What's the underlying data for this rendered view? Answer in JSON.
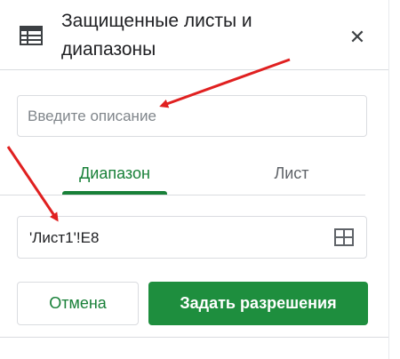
{
  "header": {
    "title_line1": "Защищенные листы и",
    "title_line2": "диапазоны"
  },
  "description": {
    "placeholder": "Введите описание",
    "value": ""
  },
  "tabs": [
    {
      "label": "Диапазон",
      "active": true
    },
    {
      "label": "Лист",
      "active": false
    }
  ],
  "range": {
    "value": "'Лист1'!E8"
  },
  "buttons": {
    "cancel": "Отмена",
    "set_permissions": "Задать разрешения"
  },
  "colors": {
    "accent": "#188038",
    "annotation_arrow": "#e02020"
  }
}
